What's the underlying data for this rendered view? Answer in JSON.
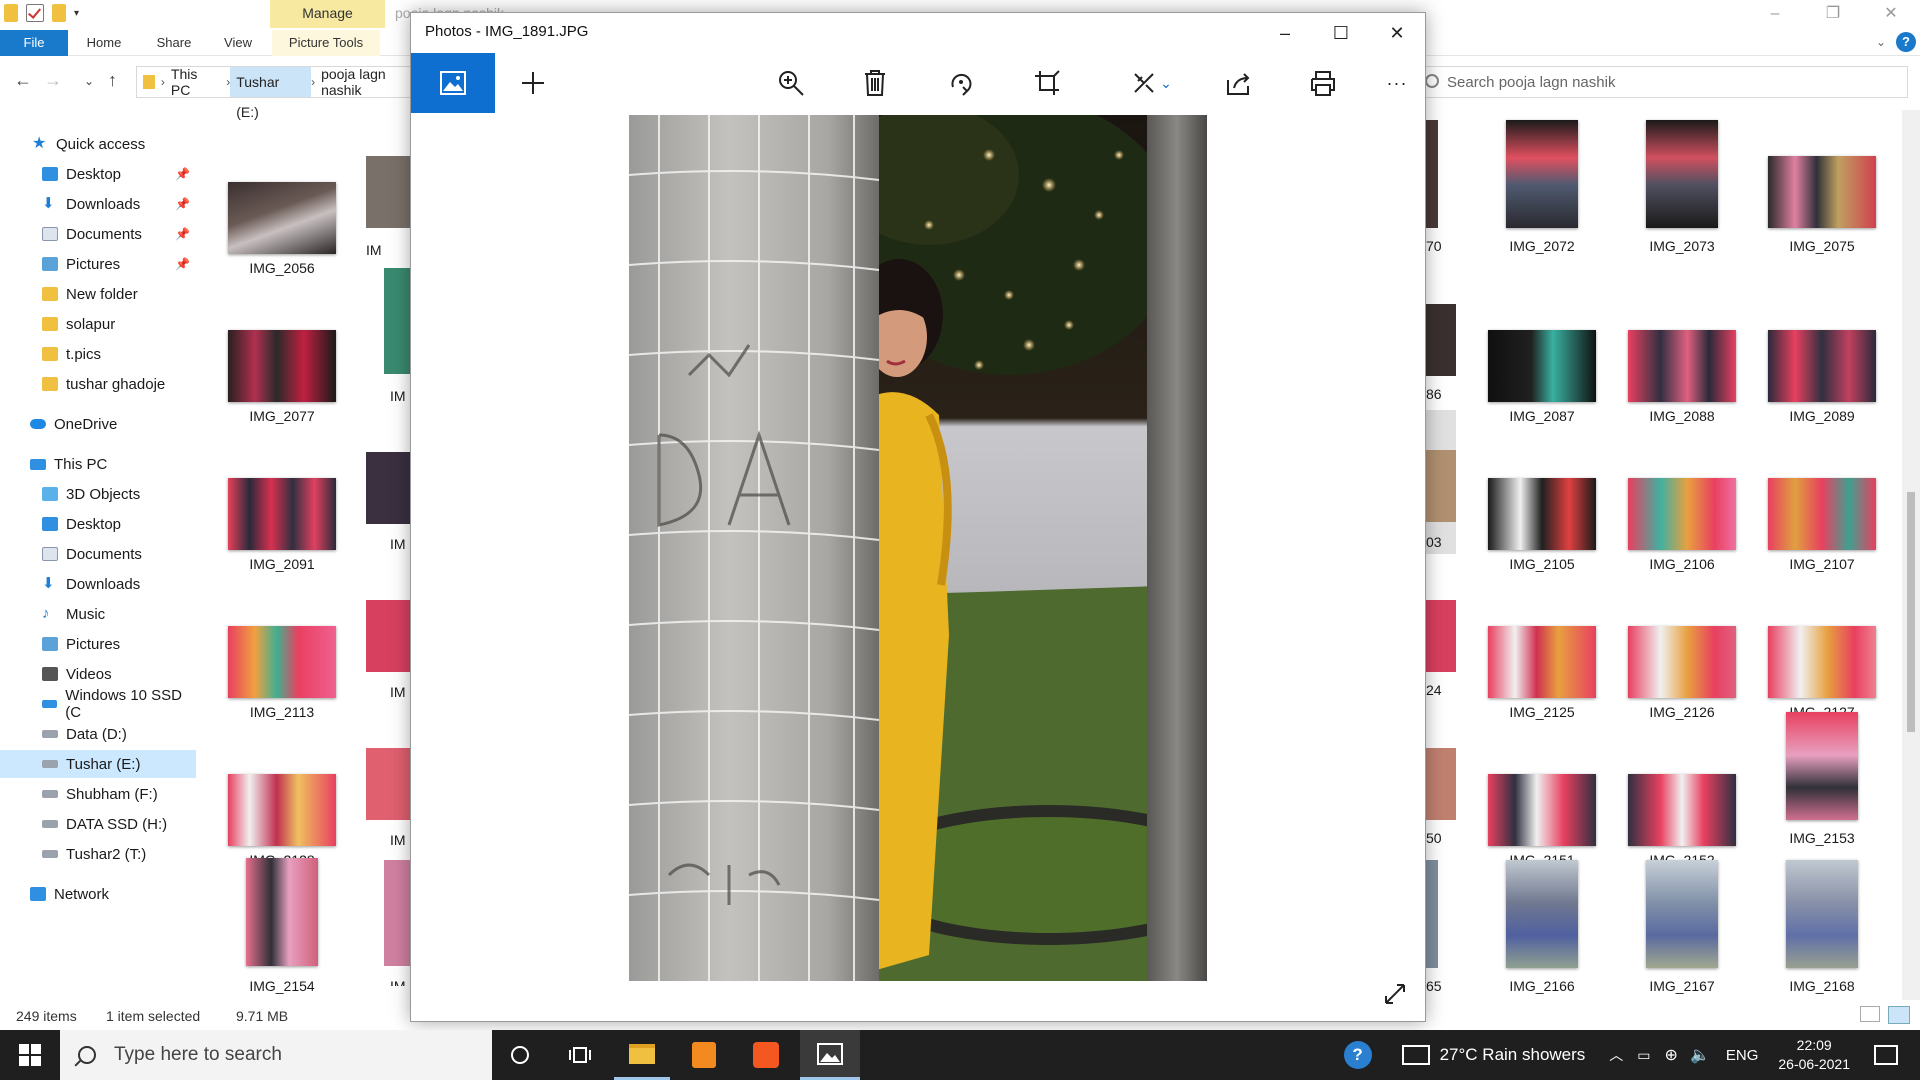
{
  "explorer": {
    "manage_tab": "Manage",
    "title_ghost": "pooja lagn nashik",
    "ribbon": {
      "file": "File",
      "home": "Home",
      "share": "Share",
      "view": "View",
      "picture_tools": "Picture Tools"
    },
    "breadcrumbs": [
      "This PC",
      "Tushar (E:)",
      "pooja lagn nashik"
    ],
    "search_placeholder": "Search pooja lagn nashik",
    "nav": {
      "quick_access": "Quick access",
      "quick_items": [
        "Desktop",
        "Downloads",
        "Documents",
        "Pictures",
        "New folder",
        "solapur",
        "t.pics",
        "tushar ghadoje"
      ],
      "onedrive": "OneDrive",
      "this_pc": "This PC",
      "pc_items": [
        "3D Objects",
        "Desktop",
        "Documents",
        "Downloads",
        "Music",
        "Pictures",
        "Videos",
        "Windows 10 SSD (C",
        "Data (D:)",
        "Tushar (E:)",
        "Shubham (F:)",
        "DATA SSD (H:)",
        "Tushar2 (T:)"
      ],
      "network": "Network",
      "selected": "Tushar (E:)"
    },
    "left_thumbs": [
      "IMG_2056",
      "IMG_2077",
      "IMG_2091",
      "IMG_2113",
      "IMG_2128",
      "IMG_2154"
    ],
    "partial_left_caps": [
      "IM",
      "IM",
      "IM",
      "IM",
      "IM",
      "IM"
    ],
    "partial_right_caps": [
      "70",
      "86",
      "03",
      "24",
      "50",
      "65"
    ],
    "right_thumbs": [
      [
        "IMG_2072",
        "IMG_2073",
        "IMG_2075"
      ],
      [
        "IMG_2087",
        "IMG_2088",
        "IMG_2089"
      ],
      [
        "IMG_2105",
        "IMG_2106",
        "IMG_2107"
      ],
      [
        "IMG_2125",
        "IMG_2126",
        "IMG_2127"
      ],
      [
        "IMG_2151",
        "IMG_2152",
        "IMG_2153"
      ],
      [
        "IMG_2166",
        "IMG_2167",
        "IMG_2168"
      ]
    ],
    "status": {
      "count": "249 items",
      "selected": "1 item selected",
      "size": "9.71 MB"
    }
  },
  "photos": {
    "title": "Photos - IMG_1891.JPG",
    "toolbar": [
      "view-icon",
      "add-icon",
      "zoom-icon",
      "delete-icon",
      "rotate-icon",
      "crop-icon",
      "edit-icon",
      "share-icon",
      "print-icon",
      "more-icon"
    ],
    "more_label": "···"
  },
  "taskbar": {
    "search_placeholder": "Type here to search",
    "weather": "27°C  Rain showers",
    "lang": "ENG",
    "time": "22:09",
    "date": "26-06-2021"
  },
  "colors": {
    "accent": "#0f6fd0",
    "ribbon_file": "#1979ca",
    "manage": "#f7e9a0",
    "taskbar": "#1f1f1f"
  }
}
